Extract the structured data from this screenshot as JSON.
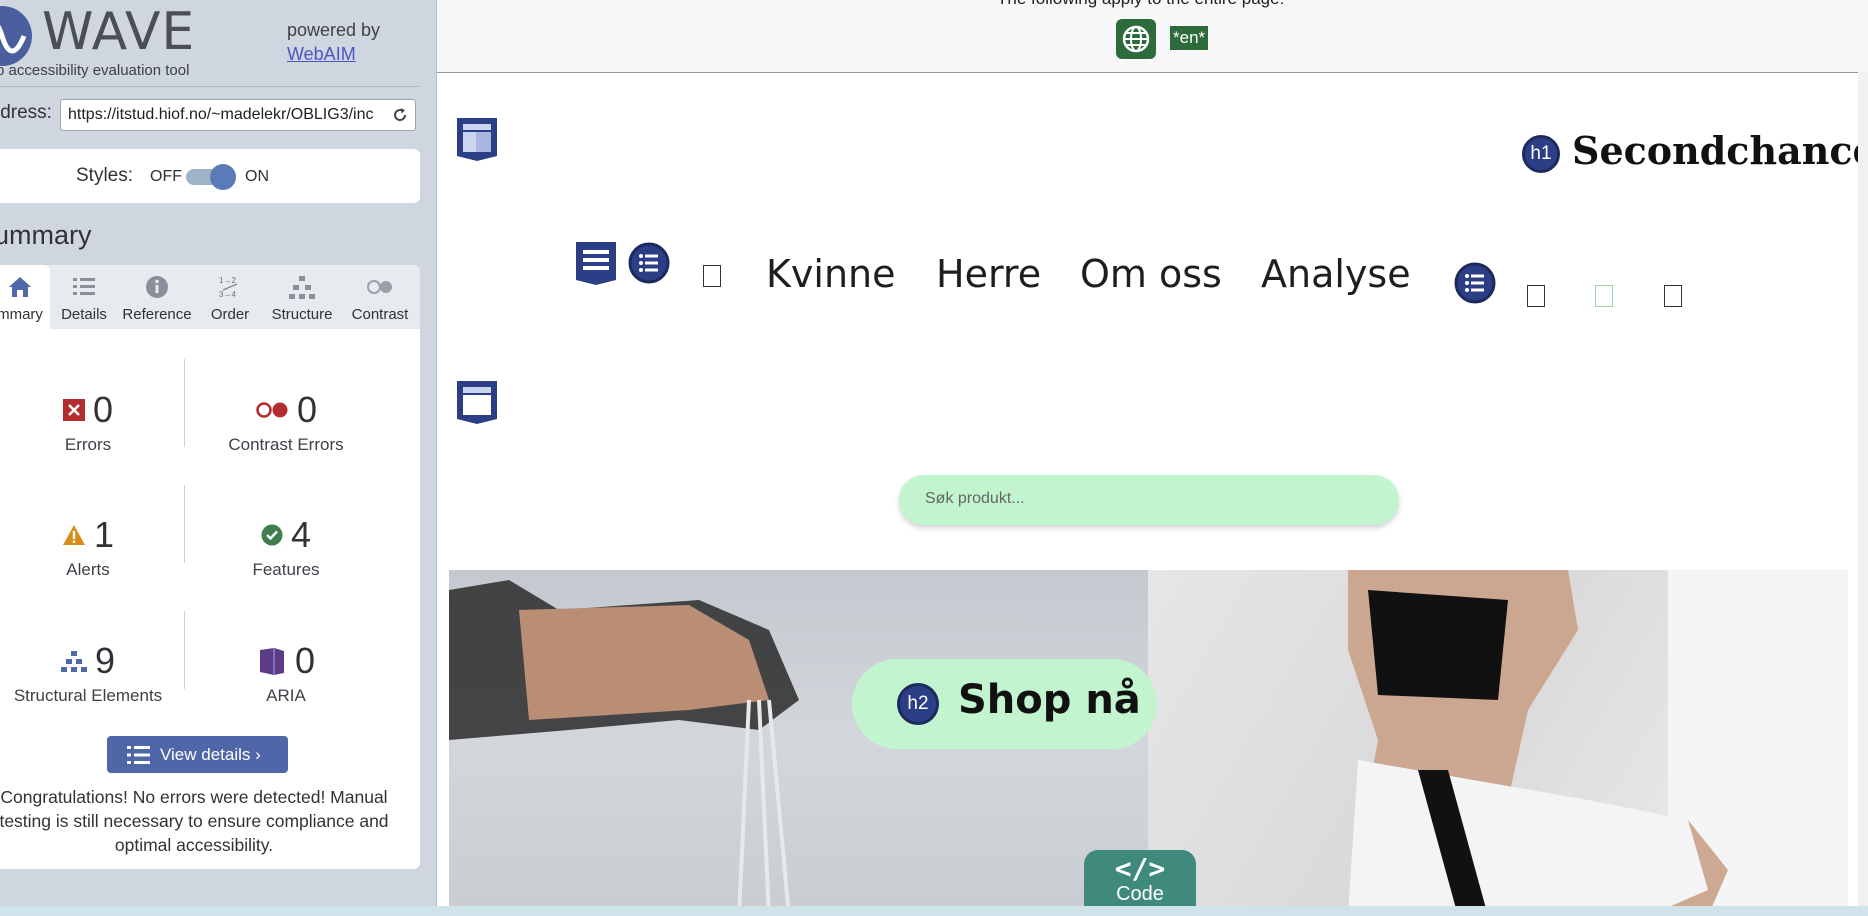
{
  "sidebar": {
    "logo_text": "WAVE",
    "tagline": "b accessibility evaluation tool",
    "powered_by": "powered by",
    "webaim_link": "WebAIM",
    "address_label": "ldress:",
    "address_value": "https://itstud.hiof.no/~madelekr/OBLIG3/inc",
    "styles_label": "Styles:",
    "styles_off": "OFF",
    "styles_on": "ON",
    "styles_enabled": true,
    "summary_title": "ummary",
    "tabs": [
      {
        "label": "mmary",
        "icon": "home-icon",
        "active": true
      },
      {
        "label": "Details",
        "icon": "list-icon",
        "active": false
      },
      {
        "label": "Reference",
        "icon": "info-icon",
        "active": false
      },
      {
        "label": "Order",
        "icon": "order-icon",
        "active": false
      },
      {
        "label": "Structure",
        "icon": "structure-icon",
        "active": false
      },
      {
        "label": "Contrast",
        "icon": "contrast-icon",
        "active": false
      }
    ],
    "stats": {
      "errors": {
        "count": "0",
        "label": "Errors",
        "icon": "error-icon"
      },
      "contrast_errors": {
        "count": "0",
        "label": "Contrast Errors",
        "icon": "contrast-error-icon"
      },
      "alerts": {
        "count": "1",
        "label": "Alerts",
        "icon": "alert-icon"
      },
      "features": {
        "count": "4",
        "label": "Features",
        "icon": "feature-icon"
      },
      "structural": {
        "count": "9",
        "label": "Structural Elements",
        "icon": "structure-icon"
      },
      "aria": {
        "count": "0",
        "label": "ARIA",
        "icon": "aria-icon"
      }
    },
    "view_details": "View details ›",
    "congrats": "Congratulations! No errors were detected! Manual testing is still necessary to ensure compliance and optimal accessibility."
  },
  "preview": {
    "doc_notice": "The following apply to the entire page:",
    "lang": "*en*",
    "h1_badge": "h1",
    "site_title": "Secondchance",
    "nav": [
      "Kvinne",
      "Herre",
      "Om oss",
      "Analyse"
    ],
    "search_placeholder": "Søk produkt...",
    "h2_badge": "h2",
    "shop_button": "Shop nå",
    "code_symbol": "</>",
    "code_label": "Code"
  },
  "colors": {
    "wave_blue": "#4f66a8",
    "error_red": "#b32d2e",
    "alert_orange": "#d98c1a",
    "feature_green": "#3f7d4f",
    "aria_purple": "#5a3d86",
    "lang_green": "#2e6b3c",
    "mint": "#c2f5cf"
  }
}
